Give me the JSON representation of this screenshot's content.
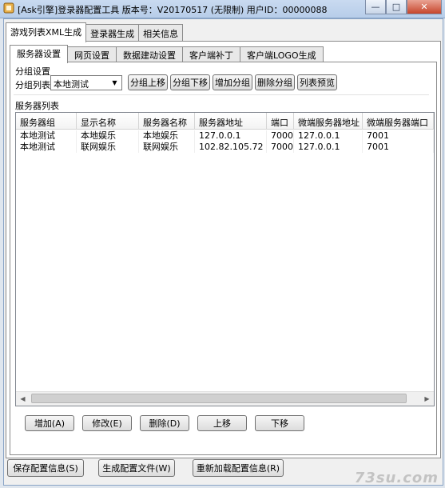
{
  "window": {
    "title": "[Ask引擎]登录器配置工具  版本号：V20170517 (无限制) 用户ID：00000088",
    "minimize_glyph": "—",
    "maximize_glyph": "□",
    "close_glyph": "✕"
  },
  "top_tabs": [
    "游戏列表XML生成",
    "登录器生成",
    "相关信息"
  ],
  "inner_tabs": [
    "服务器设置",
    "网页设置",
    "数据建动设置",
    "客户端补丁",
    "客户端LOGO生成"
  ],
  "group": {
    "title": "分组设置",
    "list_label": "分组列表：",
    "selected": "本地测试",
    "buttons": [
      "分组上移",
      "分组下移",
      "增加分组",
      "删除分组",
      "列表预览"
    ]
  },
  "server_list": {
    "title": "服务器列表",
    "columns": [
      "服务器组",
      "显示名称",
      "服务器名称",
      "服务器地址",
      "端口",
      "微端服务器地址",
      "微端服务器端口"
    ],
    "rows": [
      [
        "本地测试",
        "本地娱乐",
        "本地娱乐",
        "127.0.0.1",
        "7000",
        "127.0.0.1",
        "7001"
      ],
      [
        "本地测试",
        "联网娱乐",
        "联网娱乐",
        "102.82.105.72",
        "7000",
        "127.0.0.1",
        "7001"
      ]
    ]
  },
  "list_buttons": [
    "增加(A)",
    "修改(E)",
    "删除(D)",
    "上移",
    "下移"
  ],
  "bottom_buttons": [
    "保存配置信息(S)",
    "生成配置文件(W)",
    "重新加载配置信息(R)"
  ],
  "watermark": "73su.com",
  "colors": {
    "titlebar": "#b7cde9",
    "close_button": "#c6452b",
    "panel_bg": "#f0f0f0"
  }
}
